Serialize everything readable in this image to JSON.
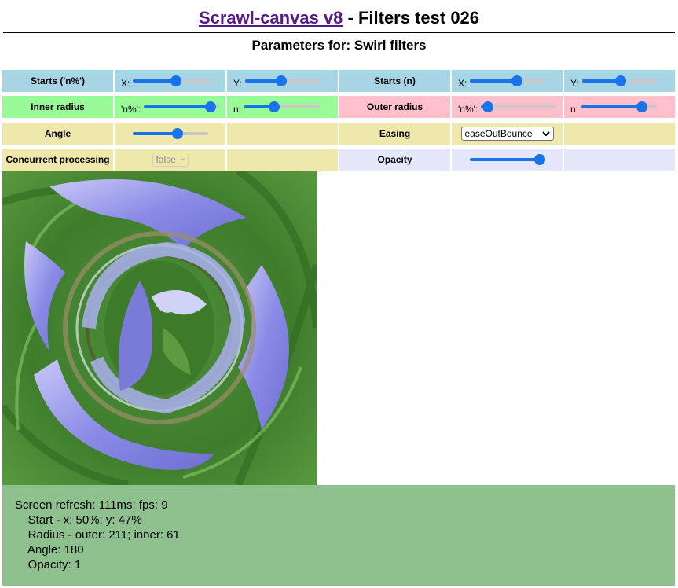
{
  "header": {
    "title_link": "Scrawl-canvas v8",
    "title_rest": " - Filters test 026",
    "subtitle": "Parameters for: Swirl filters"
  },
  "controls": {
    "starts_pct": {
      "label": "Starts ('n%')",
      "x_label": "X:",
      "x_value": 0.55,
      "y_label": "Y:",
      "y_value": 0.48
    },
    "starts_n": {
      "label": "Starts (n)",
      "x_label": "X:",
      "x_value": 0.64,
      "y_label": "Y:",
      "y_value": 0.51
    },
    "inner_radius": {
      "label": "Inner radius",
      "pct_label": "'n%':",
      "pct_value": 0.95,
      "n_label": "n:",
      "n_value": 0.38
    },
    "outer_radius": {
      "label": "Outer radius",
      "pct_label": "'n%':",
      "pct_value": 0.02,
      "n_label": "n:",
      "n_value": 0.85
    },
    "angle": {
      "label": "Angle",
      "value": 0.62
    },
    "easing": {
      "label": "Easing",
      "selected": "easeOutBounce"
    },
    "concurrent": {
      "label": "Concurrent processing",
      "selected": "false"
    },
    "opacity": {
      "label": "Opacity",
      "value": 1.0
    }
  },
  "report": {
    "line1": "Screen refresh: 111ms; fps: 9",
    "line2": "    Start - x: 50%; y: 47%",
    "line3": "    Radius - outer: 211; inner: 61",
    "line4": "    Angle: 180",
    "line5": "    Opacity: 1"
  },
  "colors": {
    "link": "#551a8b",
    "row_blue": "#a8d5e5",
    "row_green": "#98fb98",
    "row_pink": "#ffc0cb",
    "row_khaki": "#eee8aa",
    "row_lavender": "#e6e6fa",
    "report_bg": "#8fc18f",
    "slider_accent": "#1a73e8"
  },
  "icons": {
    "select_arrow": "chevron-down-icon"
  }
}
